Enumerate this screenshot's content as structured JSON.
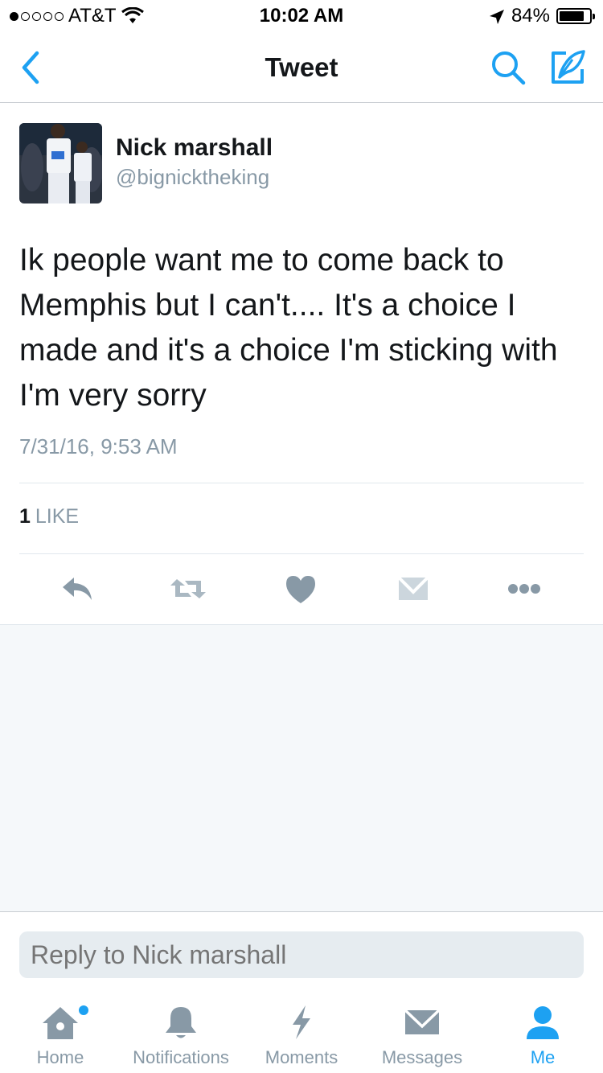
{
  "status_bar": {
    "carrier": "AT&T",
    "time": "10:02 AM",
    "battery": "84%",
    "battery_level": 0.84,
    "signal_bars_filled": 1,
    "signal_bars_total": 5
  },
  "nav": {
    "title": "Tweet",
    "back_icon": "chevron-left-icon",
    "search_icon": "search-icon",
    "compose_icon": "compose-icon"
  },
  "tweet": {
    "author_name": "Nick marshall",
    "author_handle": "@bignicktheking",
    "text": "Ik people want  me to come back to Memphis but I can't.... It's a choice I made and it's a choice I'm sticking with I'm very sorry",
    "timestamp": "7/31/16, 9:53 AM",
    "like_count": "1",
    "like_label": "LIKE"
  },
  "actions": [
    "reply-icon",
    "retweet-icon",
    "heart-icon",
    "direct-message-icon",
    "more-icon"
  ],
  "reply": {
    "placeholder": "Reply to Nick marshall"
  },
  "tabs": [
    {
      "label": "Home",
      "icon": "home-icon",
      "active": false,
      "has_dot": true
    },
    {
      "label": "Notifications",
      "icon": "bell-icon",
      "active": false,
      "has_dot": false
    },
    {
      "label": "Moments",
      "icon": "lightning-icon",
      "active": false,
      "has_dot": false
    },
    {
      "label": "Messages",
      "icon": "envelope-icon",
      "active": false,
      "has_dot": false
    },
    {
      "label": "Me",
      "icon": "person-icon",
      "active": true,
      "has_dot": false
    }
  ],
  "colors": {
    "accent": "#1da1f2",
    "text_primary": "#14171a",
    "text_secondary": "#8899a6",
    "icon_gray": "#8899a6",
    "background_gray": "#f5f8fa"
  }
}
